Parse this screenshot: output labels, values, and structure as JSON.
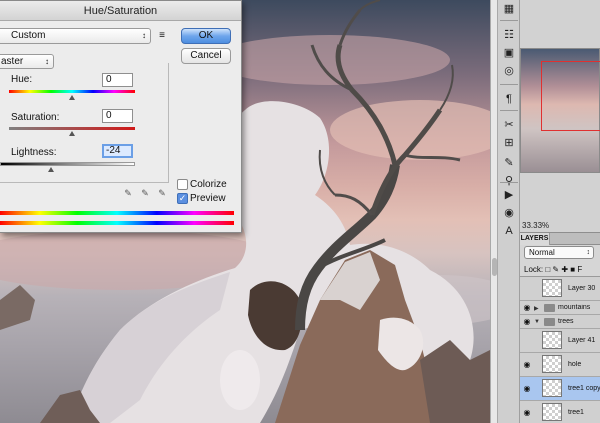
{
  "dialog": {
    "title": "Hue/Saturation",
    "preset_value": "Custom",
    "preset_options_glyph": "≡",
    "ok_label": "OK",
    "cancel_label": "Cancel",
    "channel_value": "aster",
    "hue_label": "Hue:",
    "hue_value": "0",
    "saturation_label": "Saturation:",
    "saturation_value": "0",
    "lightness_label": "Lightness:",
    "lightness_value": "-24",
    "colorize_label": "Colorize",
    "colorize_checked": false,
    "preview_label": "Preview",
    "preview_checked": true,
    "hue_slider_level": 0.5,
    "saturation_slider_level": 0.5,
    "lightness_slider_level": 0.38
  },
  "navigator": {
    "zoom_label": "33.33%"
  },
  "layers": {
    "tab_label": "LAYERS",
    "blend_mode": "Normal",
    "lock_label": "Lock:",
    "lock_icons": "□ ✎ ✚ ■",
    "fill_label": "F",
    "items": [
      {
        "name": "Layer 30",
        "visible": false,
        "type": "layer",
        "selected": false
      },
      {
        "name": "mountains",
        "visible": true,
        "type": "group",
        "selected": false
      },
      {
        "name": "trees",
        "visible": true,
        "type": "group",
        "selected": false
      },
      {
        "name": "Layer 41",
        "visible": false,
        "type": "layer",
        "selected": false
      },
      {
        "name": "hole",
        "visible": true,
        "type": "layer",
        "selected": false
      },
      {
        "name": "tree1 copy",
        "visible": true,
        "type": "layer",
        "selected": true
      },
      {
        "name": "tree1",
        "visible": true,
        "type": "layer",
        "selected": false
      }
    ]
  },
  "icons": {
    "eye": "◉",
    "collapsed": "▶",
    "expanded": "▼",
    "dropdown": "↕",
    "eyedropper": "✎",
    "check": "✓"
  },
  "colors": {
    "ok_button": "#6fa6ec",
    "selected_layer": "#a9c6ef",
    "nav_view_box": "#e03030"
  }
}
